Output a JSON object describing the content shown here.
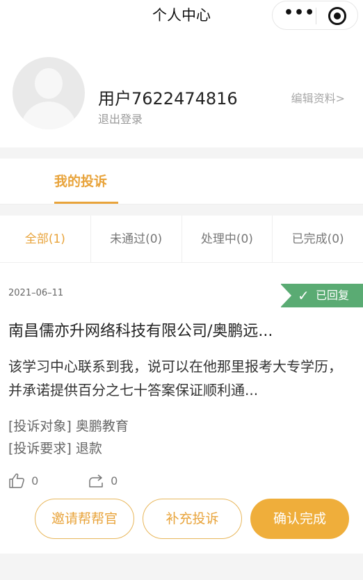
{
  "nav": {
    "title": "个人中心",
    "more_icon": "more-dots-icon",
    "close_icon": "target-circle-icon"
  },
  "profile": {
    "username": "用户7622474816",
    "logout": "退出登录",
    "edit": "编辑资料>",
    "avatar_icon": "default-avatar-icon"
  },
  "tabs": [
    {
      "label": "我的投诉",
      "active": true
    }
  ],
  "filters": [
    {
      "label": "全部(1)",
      "active": true
    },
    {
      "label": "未通过(0)",
      "active": false
    },
    {
      "label": "处理中(0)",
      "active": false
    },
    {
      "label": "已完成(0)",
      "active": false
    }
  ],
  "complaint": {
    "date": "2021–06–11",
    "status": "已回复",
    "company": "南昌儒亦升网络科技有限公司/奥鹏远...",
    "description": "该学习中心联系到我，说可以在他那里报考大专学历，并承诺提供百分之七十答案保证顺利通...",
    "target": "[投诉对象] 奥鹏教育",
    "request": "[投诉要求] 退款",
    "likes": "0",
    "shares": "0",
    "buttons": {
      "invite": "邀请帮帮官",
      "supplement": "补充投诉",
      "confirm": "确认完成"
    }
  },
  "colors": {
    "accent": "#e8a33a",
    "badge_green": "#5aab73",
    "background_gray": "#f4f4f4"
  }
}
